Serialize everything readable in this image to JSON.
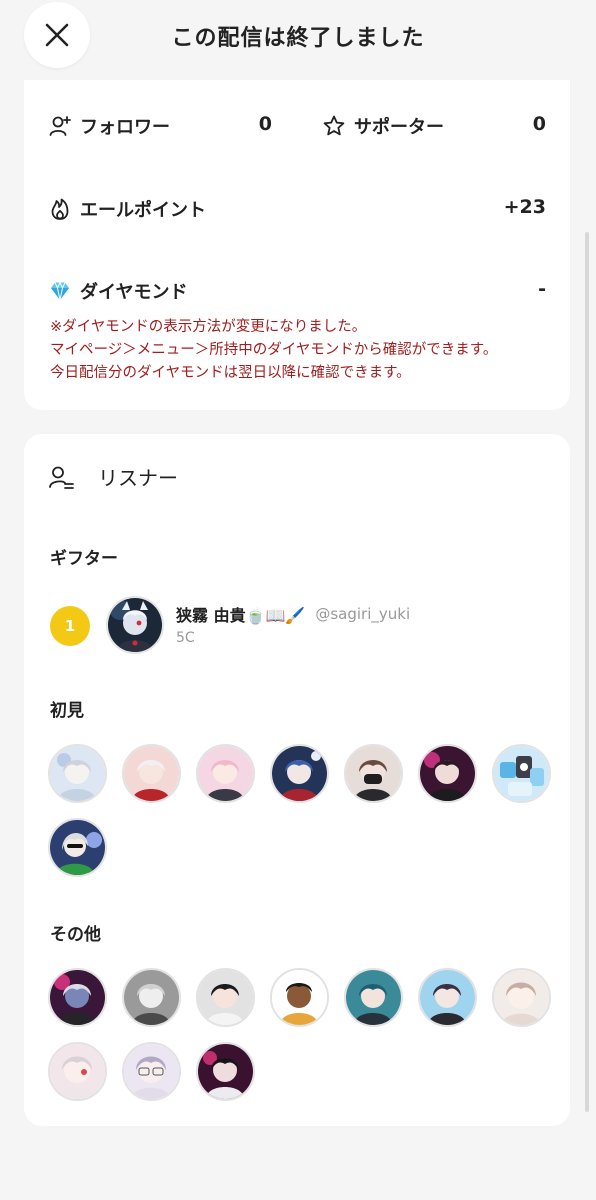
{
  "header": {
    "title": "この配信は終了しました",
    "close_icon": "close-icon"
  },
  "stats": {
    "followers_label": "フォロワー",
    "followers_value": "0",
    "supporters_label": "サポーター",
    "supporters_value": "0",
    "yell_label": "エールポイント",
    "yell_value": "+23",
    "diamond_label": "ダイヤモンド",
    "diamond_value": "-",
    "notice": [
      "※ダイヤモンドの表示方法が変更になりました。",
      "マイページ＞メニュー＞所持中のダイヤモンドから確認ができます。",
      "今日配信分のダイヤモンドは翌日以降に確認できます。"
    ]
  },
  "listeners": {
    "title": "リスナー",
    "gifter_heading": "ギフター",
    "gifter": {
      "rank": "1",
      "name": "狭霧 由貴🍵📖🖌️",
      "handle": "@sagiri_yuki",
      "coins": "5C"
    },
    "first_heading": "初見",
    "first_count": 8,
    "other_heading": "その他",
    "other_count": 10
  },
  "colors": {
    "notice": "#a31d1d",
    "rank_badge": "#f3c916",
    "background": "#f5f5f5",
    "card": "#ffffff"
  }
}
